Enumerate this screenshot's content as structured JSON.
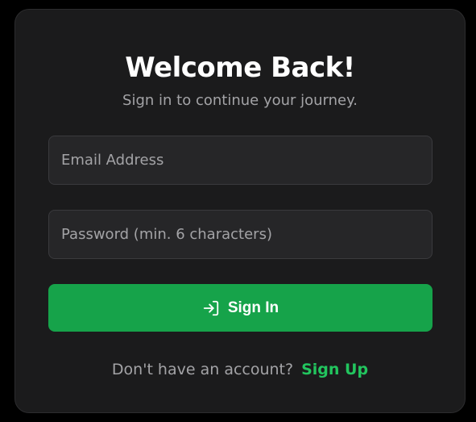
{
  "login": {
    "title": "Welcome Back!",
    "subtitle": "Sign in to continue your journey.",
    "email_placeholder": "Email Address",
    "password_placeholder": "Password (min. 6 characters)",
    "signin_label": "Sign In",
    "signin_icon": "log-in-icon",
    "footer_text": "Don't have an account?",
    "signup_label": "Sign Up"
  },
  "colors": {
    "background": "#000000",
    "card": "#1b1b1c",
    "input": "#262628",
    "accent": "#16a34a",
    "link": "#22c55e",
    "muted_text": "#a3a3a6"
  }
}
